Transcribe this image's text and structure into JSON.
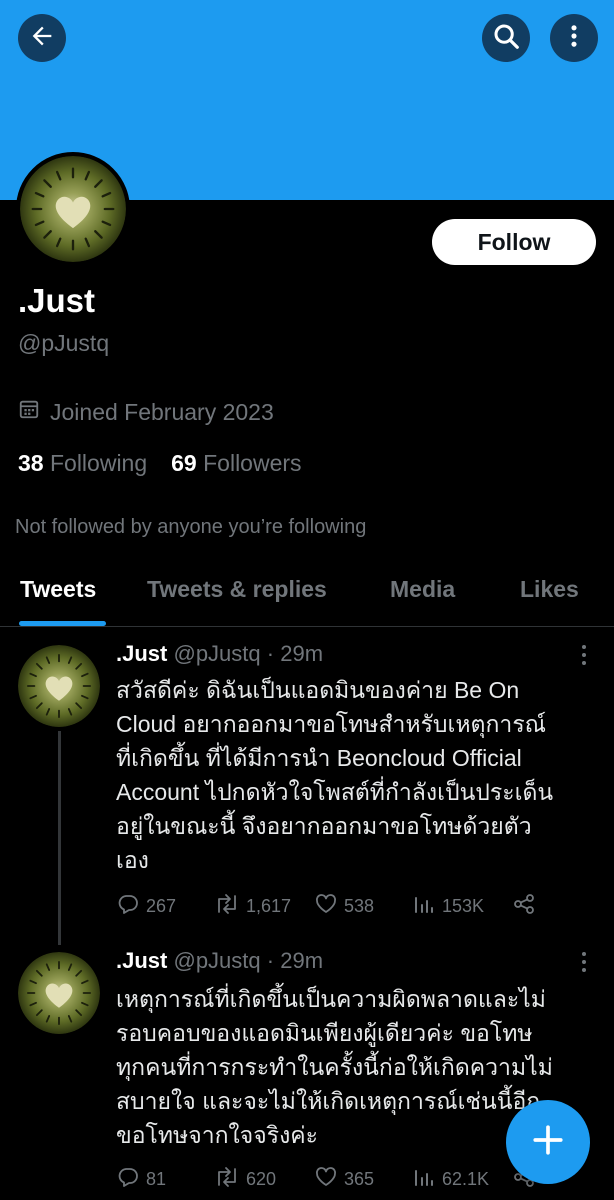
{
  "colors": {
    "banner": "#1d9bf0",
    "accent": "#1d9bf0",
    "background": "#000000",
    "muted": "#71767b"
  },
  "header": {
    "back_icon": "arrow-left-icon",
    "search_icon": "search-icon",
    "more_icon": "more-vertical-icon"
  },
  "profile": {
    "name": ".Just",
    "handle": "@pJustq",
    "follow_label": "Follow",
    "joined": "Joined February 2023",
    "following_count": "38",
    "following_label": "Following",
    "followers_count": "69",
    "followers_label": "Followers",
    "not_followed": "Not followed by anyone you’re following"
  },
  "tabs": [
    {
      "label": "Tweets",
      "active": true
    },
    {
      "label": "Tweets & replies",
      "active": false
    },
    {
      "label": "Media",
      "active": false
    },
    {
      "label": "Likes",
      "active": false
    }
  ],
  "tweets": [
    {
      "name": ".Just",
      "handle": "@pJustq",
      "time": "29m",
      "sep": "·",
      "lines": [
        "สวัสดีค่ะ ดิฉันเป็นแอดมินของค่าย Be On",
        "Cloud อยากออกมาขอโทษสำหรับเหตุการณ์",
        "ที่เกิดขึ้น ที่ได้มีการนำ Beoncloud Official",
        "Account ไปกดหัวใจโพสต์ที่กำลังเป็นประเด็น",
        "อยู่ในขณะนี้ จึงอยากออกมาขอโทษด้วยตัว",
        "เอง"
      ],
      "replies": "267",
      "retweets": "1,617",
      "likes": "538",
      "views": "153K"
    },
    {
      "name": ".Just",
      "handle": "@pJustq",
      "time": "29m",
      "sep": "·",
      "lines": [
        "เหตุการณ์ที่เกิดขึ้นเป็นความผิดพลาดและไม่",
        "รอบคอบของแอดมินเพียงผู้เดียวค่ะ ขอโทษ",
        "ทุกคนที่การกระทำในครั้งนี้ก่อให้เกิดความไม่",
        "สบายใจ และจะไม่ให้เกิดเหตุการณ์เช่นนี้อีก",
        "ขอโทษจากใจจริงค่ะ"
      ],
      "replies": "81",
      "retweets": "620",
      "likes": "365",
      "views": "62.1K"
    }
  ],
  "fab": {
    "icon": "plus-icon"
  }
}
